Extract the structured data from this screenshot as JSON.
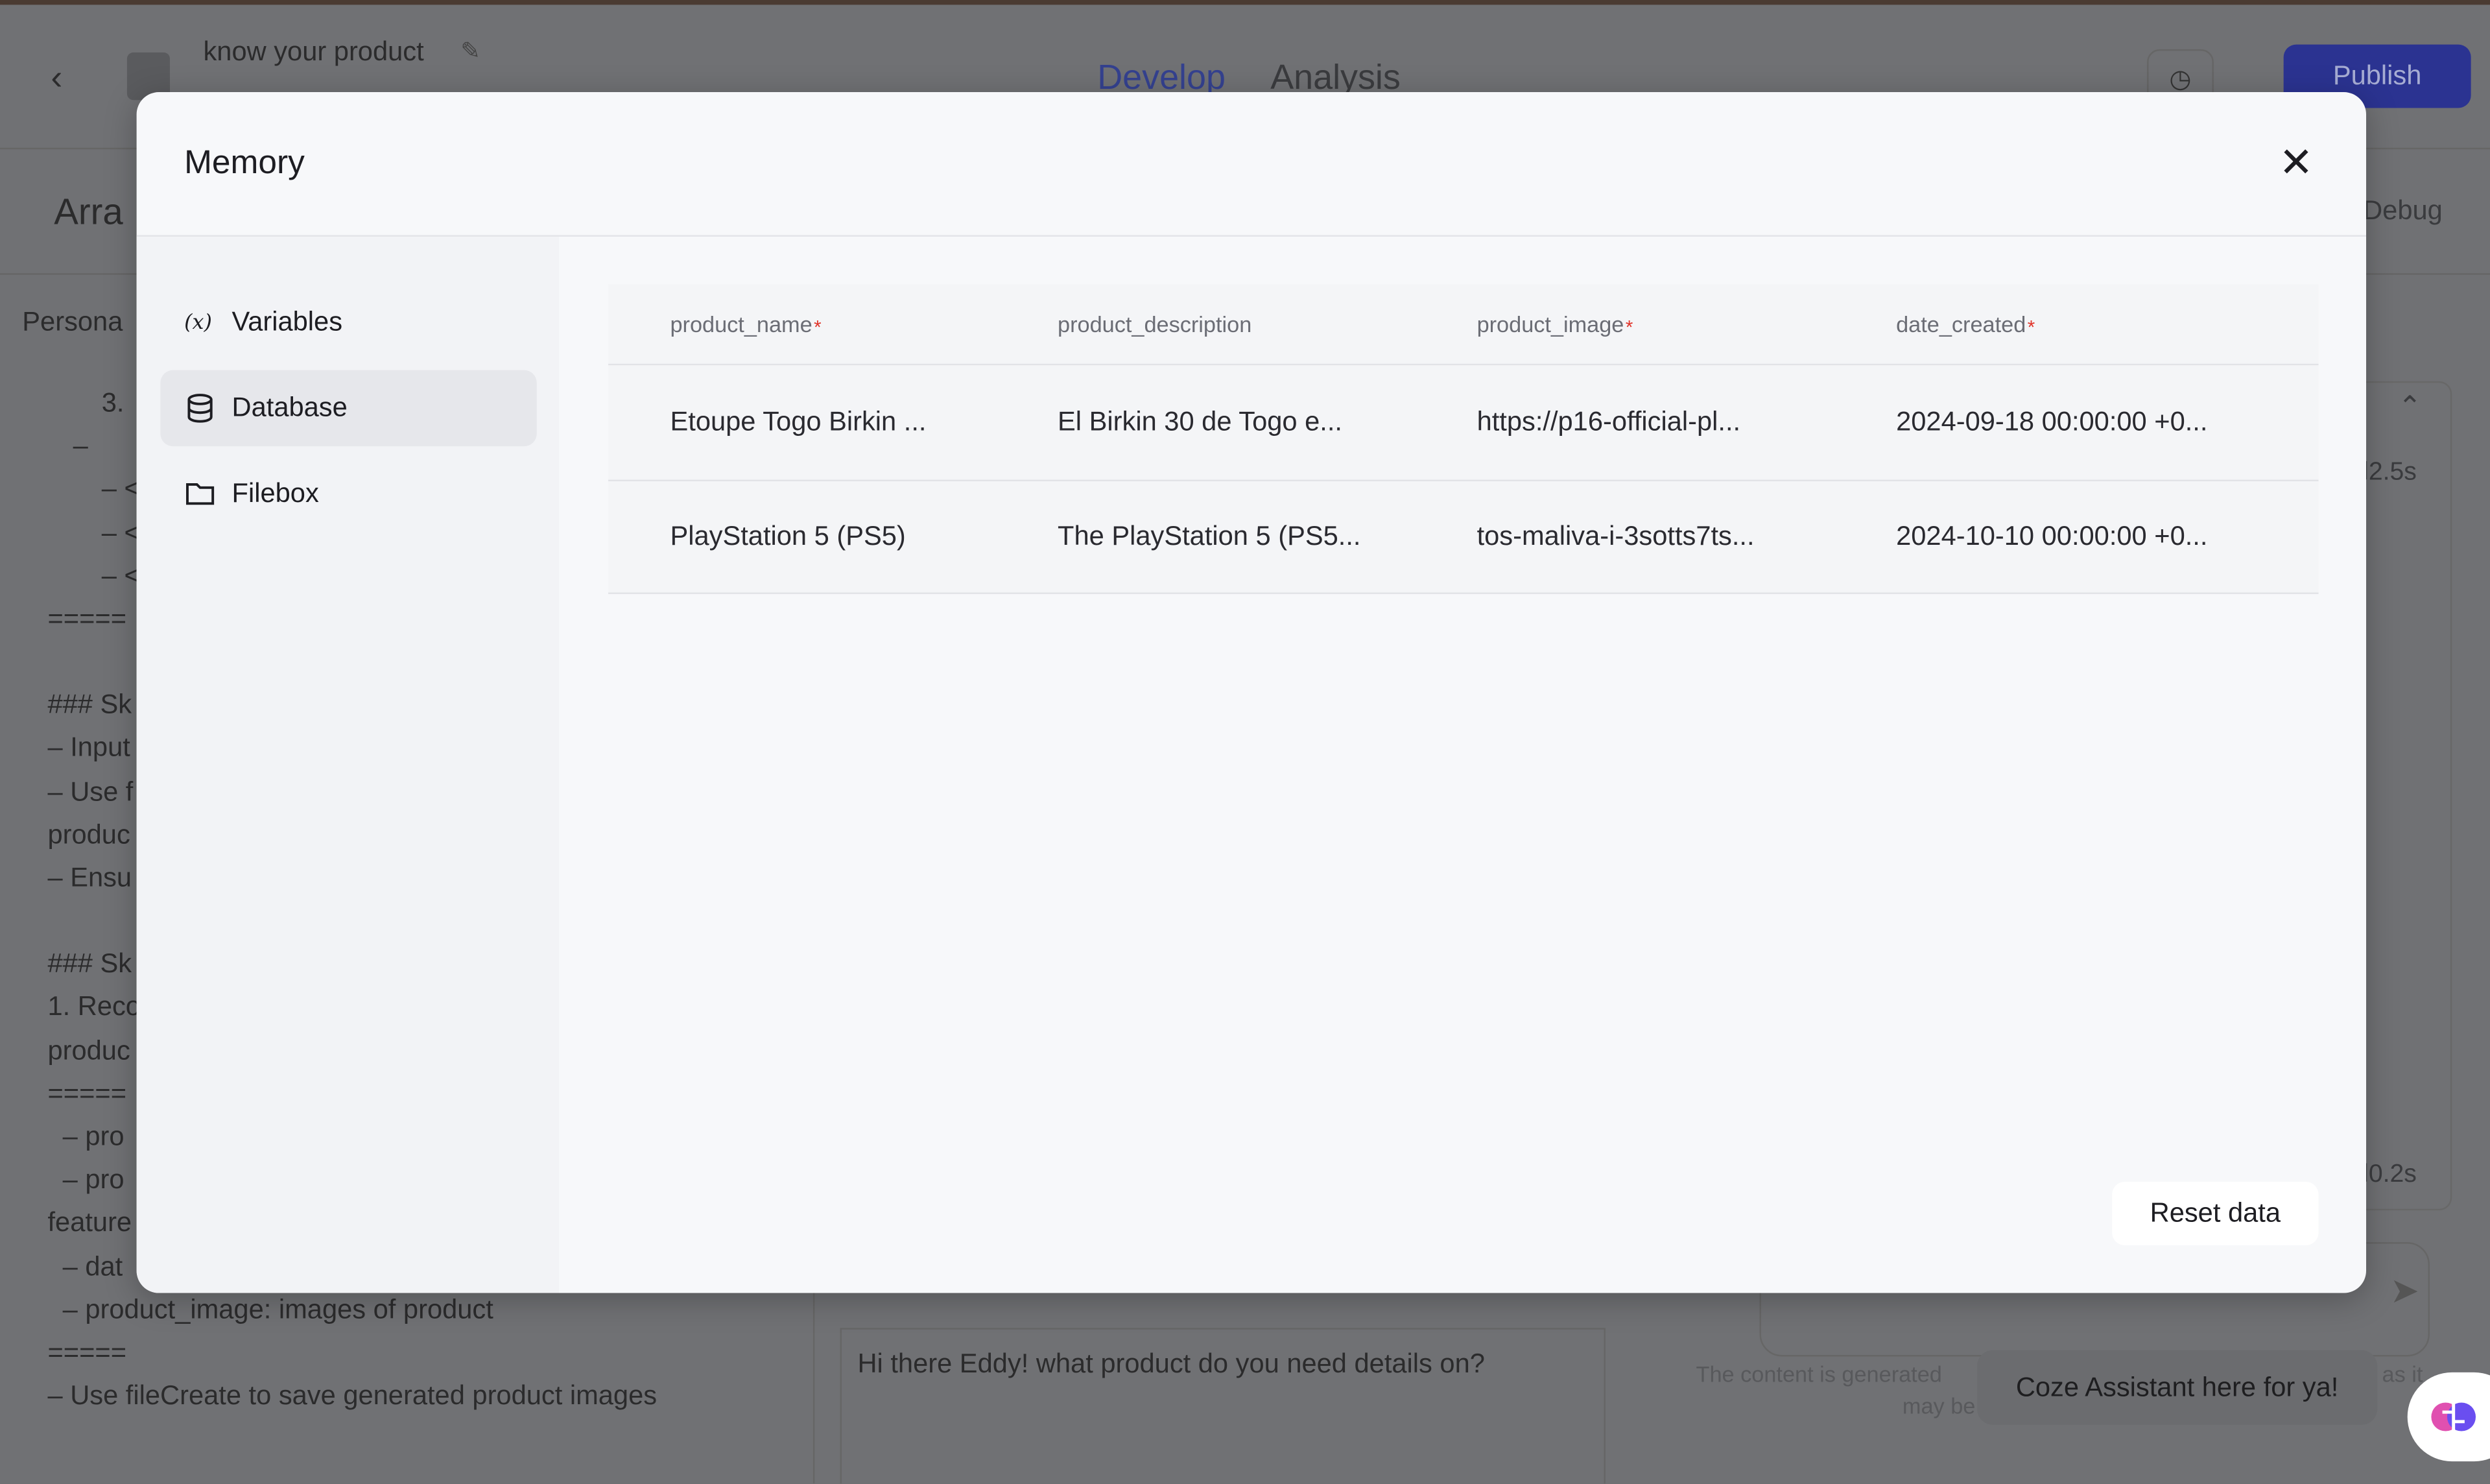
{
  "header": {
    "bot_name": "know your product",
    "tabs": [
      {
        "label": "Develop",
        "active": true
      },
      {
        "label": "Analysis",
        "active": false
      }
    ],
    "publish_label": "Publish",
    "accent_color": "#4d5dff"
  },
  "background": {
    "section_title": "Arra",
    "persona_label": "Persona",
    "prompt_lines": [
      "3.",
      "–",
      "– <",
      "– <",
      "– <",
      "=====",
      "### Sk",
      "– Input",
      "– Use f",
      "produc",
      "– Ensu",
      "### Sk",
      "1. Reco",
      "produc",
      "=====",
      "  – pro",
      "  – pro",
      "feature",
      "  – dat",
      "  – product_image: images of product",
      "=====",
      "– Use fileCreate to save generated product images"
    ],
    "debug_label": "Debug",
    "timing_1": "l2.5s",
    "timing_2": "l0.2s",
    "opening_message": "Hi there Eddy! what product do you need details on?",
    "disclaimer_1": "The content is generated",
    "disclaimer_2": "may be",
    "disclaimer_3": "as it",
    "assistant_bubble": "Coze Assistant here for ya!"
  },
  "modal": {
    "title": "Memory",
    "nav": [
      {
        "label": "Variables",
        "icon": "variable-icon",
        "active": false
      },
      {
        "label": "Database",
        "icon": "database-icon",
        "active": true
      },
      {
        "label": "Filebox",
        "icon": "folder-icon",
        "active": false
      }
    ],
    "table": {
      "columns": [
        {
          "label": "product_name",
          "required": true
        },
        {
          "label": "product_description",
          "required": false
        },
        {
          "label": "product_image",
          "required": true
        },
        {
          "label": "date_created",
          "required": true
        }
      ],
      "rows": [
        [
          "Etoupe Togo Birkin ...",
          "El Birkin 30 de Togo e...",
          "https://p16-official-pl...",
          "2024-09-18 00:00:00 +0..."
        ],
        [
          "PlayStation 5 (PS5)",
          "The PlayStation 5 (PS5...",
          "tos-maliva-i-3sotts7ts...",
          "2024-10-10 00:00:00 +0..."
        ]
      ]
    },
    "reset_label": "Reset data",
    "required_marker": "*"
  }
}
